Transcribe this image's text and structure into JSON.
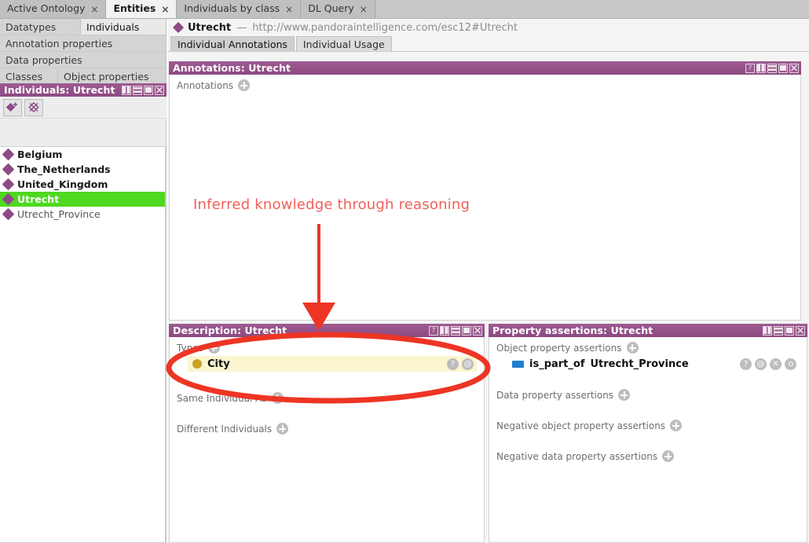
{
  "tabbar": {
    "tabs": [
      {
        "label": "Active Ontology",
        "active": false,
        "close": "×"
      },
      {
        "label": "Entities",
        "active": true,
        "close": "×"
      },
      {
        "label": "Individuals by class",
        "active": false,
        "close": "×"
      },
      {
        "label": "DL Query",
        "active": false,
        "close": "×"
      }
    ]
  },
  "entity_tabs": {
    "row1": [
      {
        "label": "Datatypes",
        "selected": false
      },
      {
        "label": "Individuals",
        "selected": true
      }
    ],
    "row2": [
      {
        "label": "Annotation properties",
        "selected": false
      }
    ],
    "row3": [
      {
        "label": "Data properties",
        "selected": false
      }
    ],
    "row4": [
      {
        "label": "Classes",
        "selected": false
      },
      {
        "label": "Object properties",
        "selected": false
      }
    ]
  },
  "individuals_panel": {
    "title": "Individuals: Utrecht",
    "buttons": [
      "split-icon",
      "minimize-icon",
      "maximize-icon",
      "close-icon"
    ],
    "toolbar": [
      {
        "name": "add-individual-button",
        "icon": "diamond-plus-icon"
      },
      {
        "name": "delete-individual-button",
        "icon": "diamond-cross-icon"
      }
    ],
    "items": [
      {
        "label": "Belgium",
        "selected": false,
        "dim": false
      },
      {
        "label": "The_Netherlands",
        "selected": false,
        "dim": false
      },
      {
        "label": "United_Kingdom",
        "selected": false,
        "dim": false
      },
      {
        "label": "Utrecht",
        "selected": true,
        "dim": false
      },
      {
        "label": "Utrecht_Province",
        "selected": false,
        "dim": true
      }
    ]
  },
  "entity_header": {
    "icon": "individual-diamond-icon",
    "name": "Utrecht",
    "dash": "—",
    "iri": "http://www.pandoraintelligence.com/esc12#Utrecht"
  },
  "sub_tabs": [
    {
      "label": "Individual Annotations",
      "active": true
    },
    {
      "label": "Individual Usage",
      "active": false
    }
  ],
  "annotations_panel": {
    "title": "Annotations: Utrecht",
    "buttons": [
      "help-icon",
      "split-icon",
      "minimize-icon",
      "maximize-icon",
      "close-icon"
    ],
    "section_label": "Annotations",
    "add_label": "+"
  },
  "description_panel": {
    "title": "Description: Utrecht",
    "buttons": [
      "help-icon",
      "split-icon",
      "minimize-icon",
      "maximize-icon",
      "close-icon"
    ],
    "sections": [
      {
        "label": "Types",
        "rows": [
          {
            "icon": "class-circle-icon",
            "text": "City",
            "inferred": true,
            "buttons": [
              "help-icon",
              "annotation-icon"
            ]
          }
        ]
      },
      {
        "label": "Same Individual As",
        "rows": []
      },
      {
        "label": "Different Individuals",
        "rows": []
      }
    ]
  },
  "property_assertions_panel": {
    "title": "Property assertions: Utrecht",
    "buttons": [
      "split-icon",
      "minimize-icon",
      "maximize-icon",
      "close-icon"
    ],
    "sections": [
      {
        "label": "Object property assertions",
        "rows": [
          {
            "icon": "object-property-icon",
            "property": "is_part_of",
            "value": "Utrecht_Province",
            "inferred": false,
            "buttons": [
              "help-icon",
              "annotation-icon",
              "delete-icon",
              "edit-icon"
            ]
          }
        ]
      },
      {
        "label": "Data property assertions",
        "rows": []
      },
      {
        "label": "Negative object property assertions",
        "rows": []
      },
      {
        "label": "Negative data property assertions",
        "rows": []
      }
    ]
  },
  "annotation_overlay": {
    "text": "Inferred knowledge through reasoning",
    "color": "#f1605a",
    "arrow": "down-arrow",
    "highlight": "red-ellipse"
  },
  "colors": {
    "panel_header": "#96528a",
    "selection_green": "#4ed820",
    "inferred_yellow": "#fbf5cf",
    "annotation_red": "#f1605a",
    "individual_purple": "#8e4a85",
    "object_property_blue": "#1e7fd4",
    "class_yellow": "#c9a227"
  }
}
